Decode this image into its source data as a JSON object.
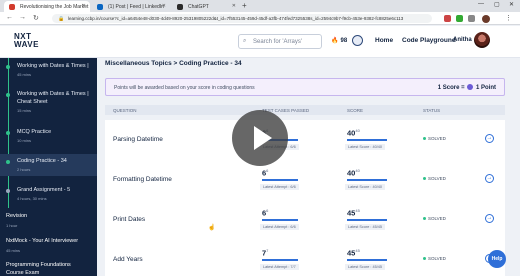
{
  "browser": {
    "tabs": [
      {
        "label": "Revolutionising the Job Market",
        "color": "#d23b2d"
      },
      {
        "label": "(1) Post | Feed | LinkedIn",
        "color": "#0a66c2"
      },
      {
        "label": "ChatGPT",
        "color": "#2b2b2b"
      }
    ],
    "url": "learning.ccbp.in/course?c_id=a6454e48-d030-4d49-8920-25319805222d&t_id=7f553145-459d-45df-a3fb-474fed7325538s_id=2594c9b7-f9cb-453e-9382-fc8825e6c113"
  },
  "header": {
    "logo_line1": "NXT",
    "logo_line2": "WAVE",
    "search_placeholder": "Search for 'Arrays'",
    "streak_count": "98",
    "nav_home": "Home",
    "nav_playground": "Code Playground",
    "user_name": "Anitha"
  },
  "sidebar": {
    "items": [
      {
        "title": "Working with Dates & Times |",
        "meta": "45 mins"
      },
      {
        "title": "Working with Dates & Times |",
        "title2": "Cheat Sheet",
        "meta": "15 mins"
      },
      {
        "title": "MCQ Practice",
        "meta": "10 mins"
      },
      {
        "title": "Coding Practice - 34",
        "meta": "2 hours"
      },
      {
        "title": "Grand Assignment - 5",
        "meta": "4 hours, 30 mins"
      }
    ],
    "sections": [
      {
        "title": "Revision",
        "meta": "1 hour"
      },
      {
        "title": "NxtMock - Your AI Interviewer",
        "meta": "45 mins"
      },
      {
        "title": "Programming Foundations",
        "title2": "Course Exam"
      }
    ]
  },
  "main": {
    "breadcrumb": "Miscellaneous Topics > Coding Practice - 34",
    "info_message": "Points will be awarded based on your score in coding questions",
    "score_rule_left": "1 Score =",
    "score_rule_right": "1 Point",
    "columns": {
      "question": "QUESTION",
      "tests": "TEST CASES PASSED",
      "score": "SCORE",
      "status": "STATUS"
    },
    "rows": [
      {
        "name": "Parsing Datetime",
        "passed": "6",
        "total": "6",
        "latest_attempt": "Latest Attempt : 6/6",
        "score": "40",
        "max": "40",
        "latest_score": "Latest Score : 40/40",
        "status": "SOLVED"
      },
      {
        "name": "Formatting Datetime",
        "passed": "6",
        "total": "6",
        "latest_attempt": "Latest Attempt : 6/6",
        "score": "40",
        "max": "40",
        "latest_score": "Latest Score : 40/40",
        "status": "SOLVED"
      },
      {
        "name": "Print Dates",
        "passed": "6",
        "total": "6",
        "latest_attempt": "Latest Attempt : 6/6",
        "score": "45",
        "max": "45",
        "latest_score": "Latest Score : 45/45",
        "status": "SOLVED"
      },
      {
        "name": "Add Years",
        "passed": "7",
        "total": "7",
        "latest_attempt": "Latest Attempt : 7/7",
        "score": "45",
        "max": "45",
        "latest_score": "Latest Score : 45/45",
        "status": "SOLVED"
      }
    ],
    "help_label": "Help"
  }
}
